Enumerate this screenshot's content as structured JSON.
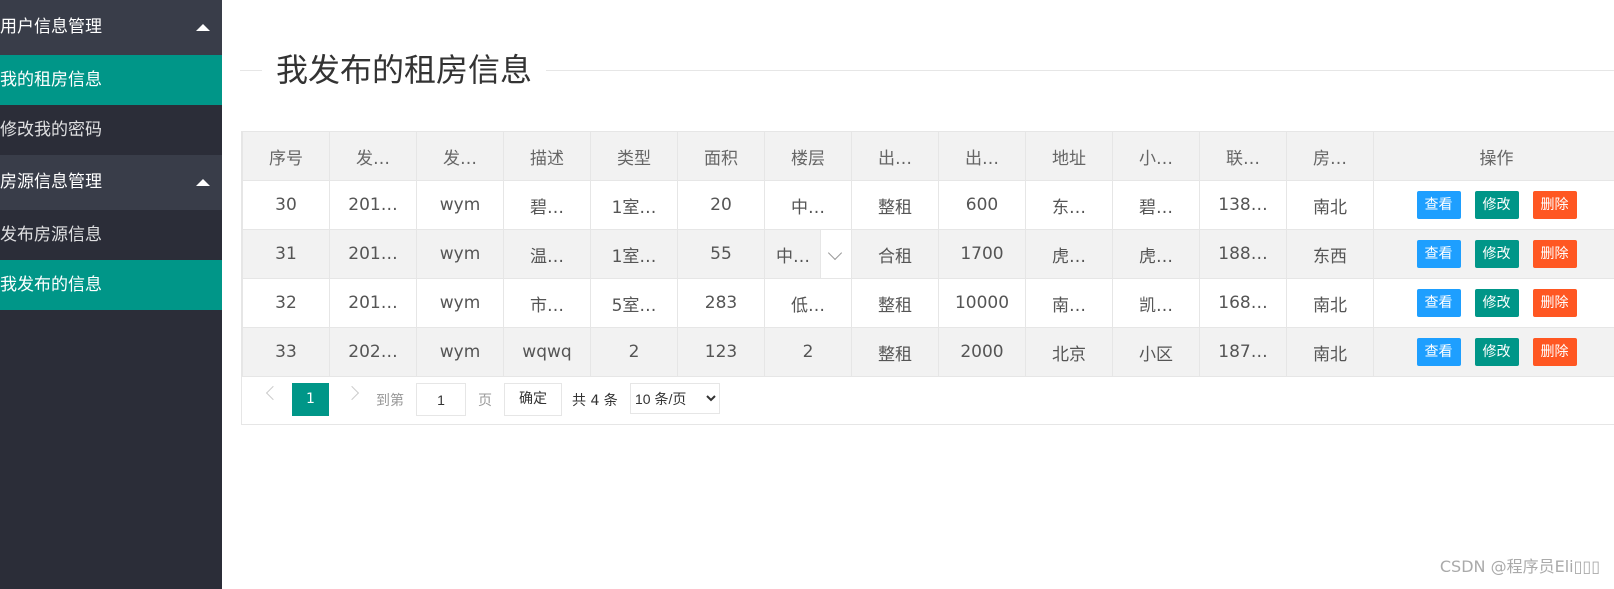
{
  "sidebar": {
    "groups": [
      {
        "label": "用户信息管理",
        "items": [
          {
            "label": "我的租房信息",
            "active": true
          },
          {
            "label": "修改我的密码",
            "active": false
          }
        ]
      },
      {
        "label": "房源信息管理",
        "items": [
          {
            "label": "发布房源信息",
            "active": false
          },
          {
            "label": "我发布的信息",
            "active": true
          }
        ]
      }
    ]
  },
  "main": {
    "title": "我发布的租房信息"
  },
  "table": {
    "headers": [
      "序号",
      "发…",
      "发…",
      "描述",
      "类型",
      "面积",
      "楼层",
      "出…",
      "出…",
      "地址",
      "小…",
      "联…",
      "房…",
      "操作"
    ],
    "rows": [
      [
        "30",
        "201…",
        "wym",
        "碧…",
        "1室…",
        "20",
        "中…",
        "整租",
        "600",
        "东…",
        "碧…",
        "138…",
        "南北"
      ],
      [
        "31",
        "201…",
        "wym",
        "温…",
        "1室…",
        "55",
        "中…",
        "合租",
        "1700",
        "虎…",
        "虎…",
        "188…",
        "东西"
      ],
      [
        "32",
        "201…",
        "wym",
        "市…",
        "5室…",
        "283",
        "低…",
        "整租",
        "10000",
        "南…",
        "凯…",
        "168…",
        "南北"
      ],
      [
        "33",
        "202…",
        "wym",
        "wqwq",
        "2",
        "123",
        "2",
        "整租",
        "2000",
        "北京",
        "小区",
        "187…",
        "南北"
      ]
    ],
    "actions": {
      "view": "查看",
      "edit": "修改",
      "delete": "删除"
    }
  },
  "pager": {
    "current_page": "1",
    "goto_label": "到第",
    "goto_value": "1",
    "page_label": "页",
    "confirm_label": "确定",
    "total_label": "共 4 条",
    "page_size_option": "10 条/页"
  },
  "watermark": "CSDN @程序员Eli▯▯▯",
  "colors": {
    "sidebar_bg": "#2b2d38",
    "group_bg": "#393d49",
    "accent": "#009688",
    "view_btn": "#1e9fff",
    "delete_btn": "#ff5722"
  }
}
